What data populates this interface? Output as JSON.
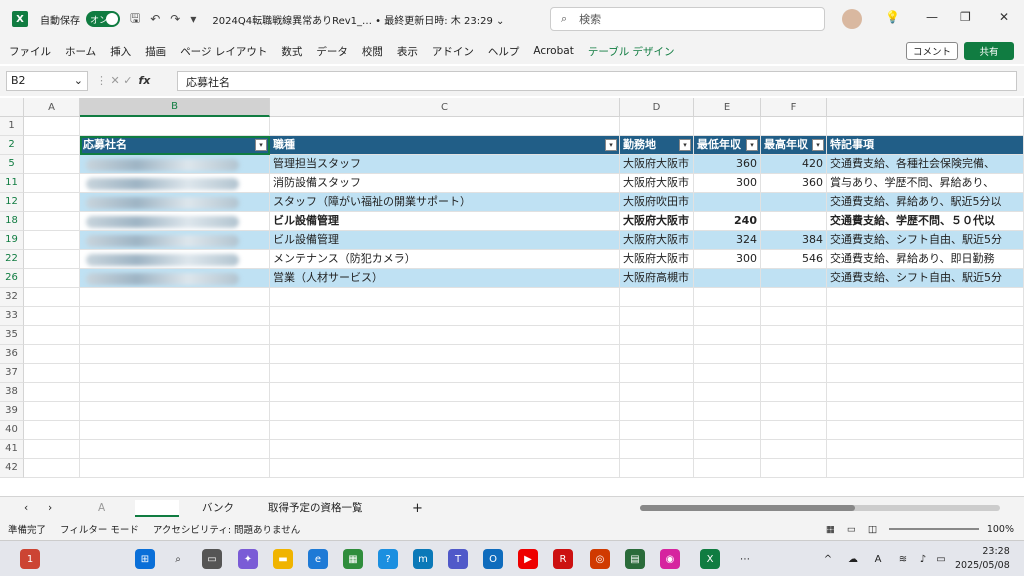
{
  "title": {
    "autosave_label": "自動保存",
    "autosave_state": "オン",
    "doc_title": "2024Q4転職戦線異常ありRev1_… • 最終更新日時: 木 23:29 ⌄",
    "search_placeholder": "検索"
  },
  "menu": {
    "items": [
      "ファイル",
      "ホーム",
      "挿入",
      "描画",
      "ページ レイアウト",
      "数式",
      "データ",
      "校閲",
      "表示",
      "アドイン",
      "ヘルプ",
      "Acrobat",
      "テーブル デザイン"
    ],
    "comment_label": "コメント",
    "share_label": "共有"
  },
  "formula": {
    "namebox": "B2",
    "content": "応募社名"
  },
  "columns": [
    "A",
    "B",
    "C",
    "D",
    "E",
    "F"
  ],
  "table": {
    "headers": [
      "応募社名",
      "職種",
      "勤務地",
      "最低年収",
      "最高年収",
      "特記事項"
    ],
    "rows": [
      {
        "row": "5",
        "title": "管理担当スタッフ",
        "place": "大阪府大阪市",
        "min": "360",
        "max": "420",
        "note": "交通費支給、各種社会保険完備、",
        "bold": false
      },
      {
        "row": "11",
        "title": "消防設備スタッフ",
        "place": "大阪府大阪市",
        "min": "300",
        "max": "360",
        "note": "賞与あり、学歴不問、昇給あり、",
        "bold": false
      },
      {
        "row": "12",
        "title": "スタッフ（障がい福祉の開業サポート）",
        "place": "大阪府吹田市",
        "min": "",
        "max": "",
        "note": "交通費支給、昇給あり、駅近5分以",
        "bold": false
      },
      {
        "row": "18",
        "title": "ビル設備管理",
        "place": "大阪府大阪市",
        "min": "240",
        "max": "",
        "note": "交通費支給、学歴不問、５０代以",
        "bold": true
      },
      {
        "row": "19",
        "title": "ビル設備管理",
        "place": "大阪府大阪市",
        "min": "324",
        "max": "384",
        "note": "交通費支給、シフト自由、駅近5分",
        "bold": false
      },
      {
        "row": "22",
        "title": "メンテナンス（防犯カメラ）",
        "place": "大阪府大阪市",
        "min": "300",
        "max": "546",
        "note": "交通費支給、昇給あり、即日勤務",
        "bold": false
      },
      {
        "row": "26",
        "title": "営業（人材サービス）",
        "place": "大阪府高槻市",
        "min": "",
        "max": "",
        "note": "交通費支給、シフト自由、駅近5分",
        "bold": false
      }
    ],
    "empty_rows": [
      "32",
      "33",
      "35",
      "36",
      "37",
      "38",
      "39",
      "40",
      "41",
      "42"
    ]
  },
  "sheets": {
    "tabs": [
      "A",
      "",
      "バンク",
      "取得予定の資格一覧"
    ],
    "add": "+"
  },
  "status": {
    "ready": "準備完了",
    "filter": "フィルター モード",
    "accessibility": "アクセシビリティ: 問題ありません",
    "zoom": "100%"
  },
  "clock": {
    "time": "23:28",
    "date": "2025/05/08"
  }
}
